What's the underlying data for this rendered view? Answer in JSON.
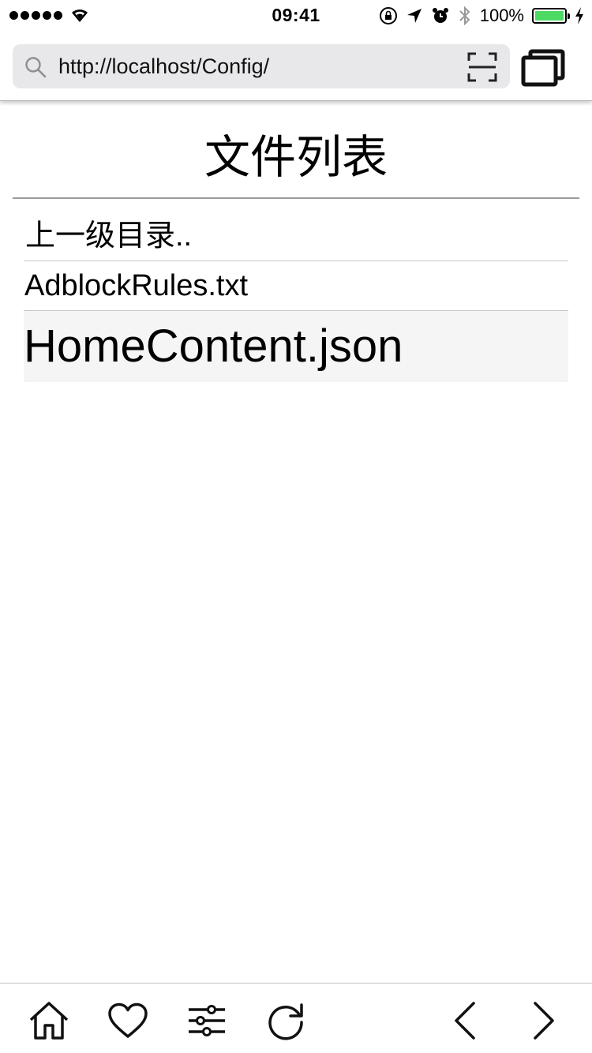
{
  "status_bar": {
    "time": "09:41",
    "battery_percent": "100%",
    "battery_level": 1.0,
    "signal_bars": 5
  },
  "address_bar": {
    "url": "http://localhost/Config/"
  },
  "page": {
    "title": "文件列表",
    "files": [
      {
        "label": "上一级目录..",
        "kind": "parent"
      },
      {
        "label": "AdblockRules.txt",
        "kind": "normal"
      },
      {
        "label": "HomeContent.json",
        "kind": "selected"
      }
    ]
  },
  "toolbar": {
    "icons": [
      "home-icon",
      "heart-icon",
      "sliders-icon",
      "refresh-icon",
      "back-arrow-icon",
      "forward-arrow-icon"
    ]
  },
  "colors": {
    "battery_fill": "#4cd964",
    "url_field_bg": "#e8e8ea",
    "selected_row_bg": "#f5f5f5"
  }
}
